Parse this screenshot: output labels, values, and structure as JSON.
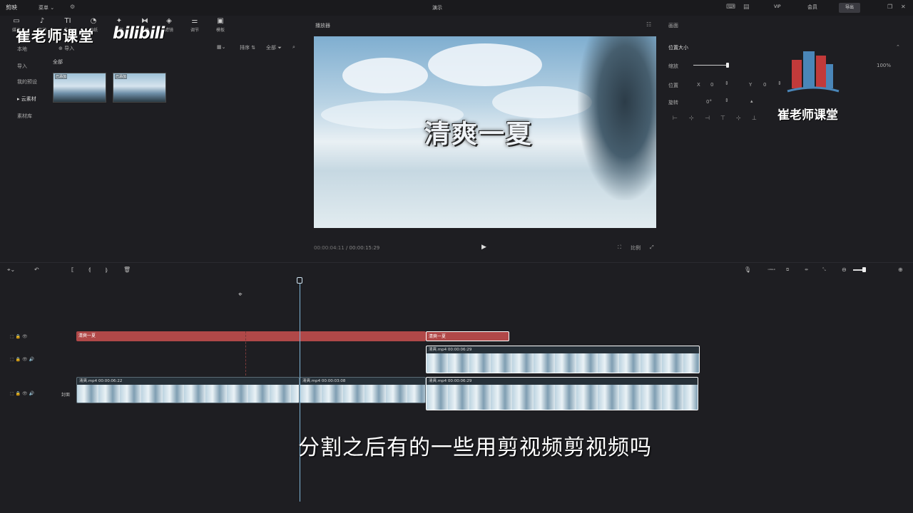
{
  "topbar": {
    "app_name": "剪映",
    "menu": "菜单 ⌄",
    "title": "演示",
    "vip": "VIP",
    "account": "会员",
    "export": "导出"
  },
  "media_toolbar": {
    "tools": [
      {
        "icon": "video-icon",
        "label": "媒体"
      },
      {
        "icon": "audio-icon",
        "label": "音频"
      },
      {
        "icon": "text-icon",
        "label": "文本"
      },
      {
        "icon": "sticker-icon",
        "label": "贴纸"
      },
      {
        "icon": "effects-icon",
        "label": "特效"
      },
      {
        "icon": "transition-icon",
        "label": "转场"
      },
      {
        "icon": "filter-icon",
        "label": "滤镜"
      },
      {
        "icon": "adjust-icon",
        "label": "调节"
      },
      {
        "icon": "template-icon",
        "label": "模板"
      }
    ]
  },
  "watermark": {
    "brand_left": "崔老师课堂",
    "bilibili": "bilibili",
    "brand_right": "崔老师课堂"
  },
  "sidebar": {
    "items": [
      {
        "label": "本地"
      },
      {
        "label": "导入"
      },
      {
        "label": "我的预设"
      },
      {
        "label": "云素材"
      },
      {
        "label": "素材库"
      }
    ]
  },
  "media": {
    "import_label": "导入",
    "tab_all": "全部",
    "sort_label": "排序",
    "filter_label": "全部",
    "clips": [
      {
        "tag": "已添加"
      },
      {
        "tag": "已添加"
      }
    ]
  },
  "player": {
    "label": "播放器",
    "video_title": "清爽一夏",
    "current_time": "00:00:04:11",
    "total_time": "00:00:15:29",
    "ratio_label": "比例"
  },
  "properties": {
    "header": "画面",
    "section": "位置大小",
    "scale_label": "缩放",
    "scale_value": "100%",
    "position_label": "位置",
    "x_label": "X",
    "x_value": "0",
    "y_label": "Y",
    "y_value": "0",
    "rotate_label": "旋转",
    "rotate_value": "0°"
  },
  "timeline": {
    "cover_label": "封面",
    "text_clips": [
      {
        "label": "清爽一夏"
      },
      {
        "label": "清爽一夏"
      }
    ],
    "video_clips": [
      {
        "label": "清爽.mp4  00:00:06:22"
      },
      {
        "label": "清爽.mp4  00:00:03:08"
      },
      {
        "label": "清爽.mp4  00:00:06:29"
      },
      {
        "label": "清爽.mp4  00:00:06:29"
      }
    ]
  },
  "subtitle": "分割之后有的一些用剪视频剪视频吗",
  "colors": {
    "text_clip": "#b04848",
    "playhead": "#7fb4d6",
    "background": "#1e1e22"
  }
}
